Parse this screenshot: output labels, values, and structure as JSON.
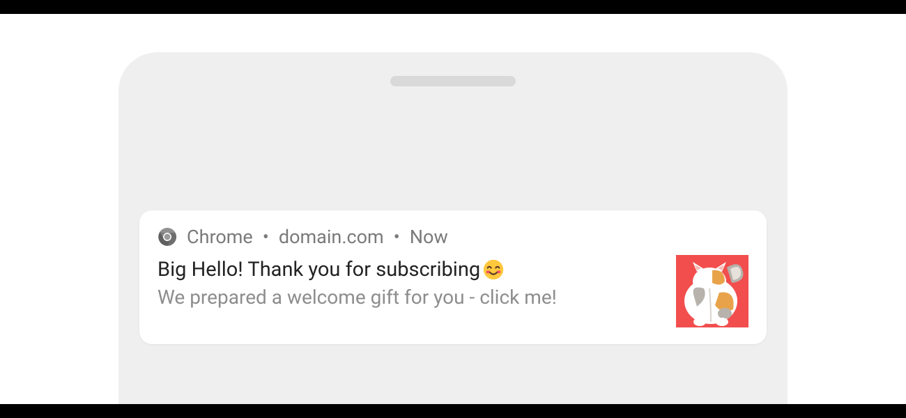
{
  "notification": {
    "app": "Chrome",
    "domain": "domain.com",
    "time": "Now",
    "title": "Big Hello! Thank you for subscribing",
    "message": "We prepared a welcome gift for you - click me!",
    "image_bg": "#F24E4E"
  }
}
